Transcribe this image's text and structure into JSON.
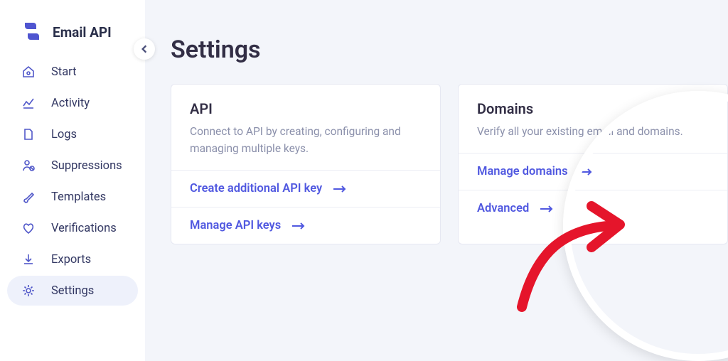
{
  "app": {
    "name": "Email API"
  },
  "sidebar": {
    "items": [
      {
        "label": "Start"
      },
      {
        "label": "Activity"
      },
      {
        "label": "Logs"
      },
      {
        "label": "Suppressions"
      },
      {
        "label": "Templates"
      },
      {
        "label": "Verifications"
      },
      {
        "label": "Exports"
      },
      {
        "label": "Settings"
      }
    ]
  },
  "page": {
    "title": "Settings"
  },
  "cards": {
    "api": {
      "title": "API",
      "desc": "Connect to API by creating, configuring and managing multiple keys.",
      "actions": {
        "create": "Create additional API key",
        "manage": "Manage API keys"
      }
    },
    "domains": {
      "title": "Domains",
      "desc": "Verify all your existing email and domains.",
      "actions": {
        "manage": "Manage domains",
        "advanced": "Advanced"
      }
    }
  }
}
